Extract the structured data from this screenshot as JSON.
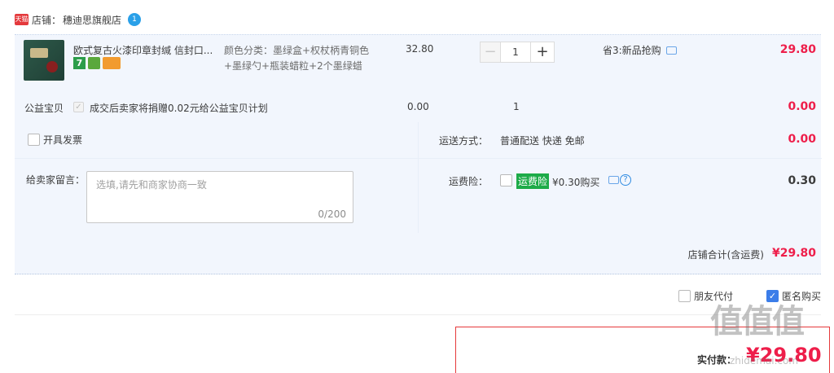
{
  "shop": {
    "badge": "天猫",
    "label": "店铺：",
    "name": "穗迪思旗舰店",
    "ww_count": "1"
  },
  "item": {
    "title": "欧式复古火漆印章封缄 信封口...",
    "sku_label": "颜色分类：",
    "sku_value": "墨绿盒+权杖柄青铜色+墨绿勺+瓶装蜡粒+2个墨绿蜡",
    "price": "32.80",
    "tag7": "7",
    "quantity": "1",
    "minus": "−",
    "plus": "+",
    "promo": "省3:新品抢购",
    "subtotal": "29.80"
  },
  "charity": {
    "label": "公益宝贝",
    "text": "成交后卖家将捐赠0.02元给公益宝贝计划",
    "price": "0.00",
    "qty": "1",
    "total": "0.00"
  },
  "invoice": {
    "label": "开具发票"
  },
  "message": {
    "label": "给卖家留言：",
    "placeholder": "选填,请先和商家协商一致",
    "count": "0/200"
  },
  "shipping": {
    "label": "运送方式：",
    "value": "普通配送 快递 免邮",
    "total": "0.00"
  },
  "insurance": {
    "label": "运费险：",
    "badge": "运费险",
    "price": "¥0.30购买",
    "total": "0.30"
  },
  "shop_total": {
    "label": "店铺合计(含运费)",
    "value": "¥29.80"
  },
  "options": {
    "friend_pay": "朋友代付",
    "anonymous": "匿名购买"
  },
  "pay": {
    "label": "实付款：",
    "value": "¥29.80"
  },
  "watermark": {
    "text": "值值值",
    "sub": "zhidemai.com"
  },
  "colors": {
    "price_red": "#ee1e4a",
    "row_bg": "#f2f6fd",
    "checkbox_blue": "#3b7de9",
    "insurance_green": "#1dab48"
  }
}
